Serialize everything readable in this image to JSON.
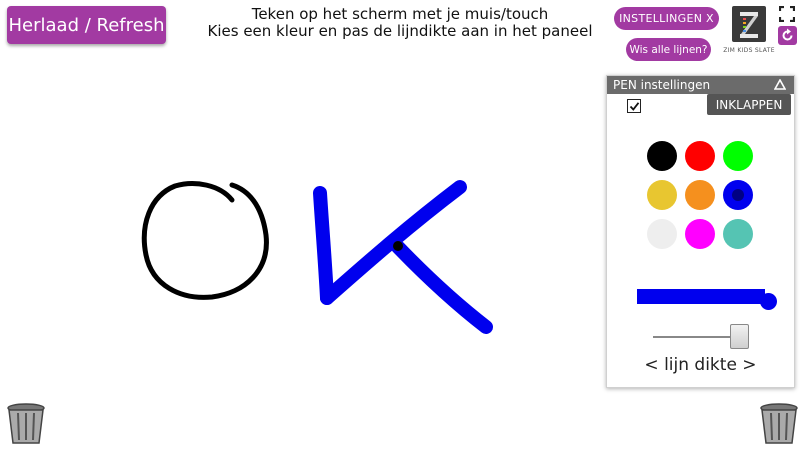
{
  "toolbar": {
    "refresh_label": "Herlaad / Refresh",
    "settings_label": "INSTELLINGEN X",
    "see_all_lines_label": "Wis alle lijnen?",
    "logo_caption": "ZIM KIDS SLATE"
  },
  "instructions": {
    "line1": "Teken op het scherm met je muis/touch",
    "line2": "Kies een kleur en pas de lijndikte aan in het paneel"
  },
  "panel": {
    "title": "PEN instellingen",
    "collapse_tooltip": "INKLAPPEN",
    "checkbox_checked": true,
    "swatches": [
      {
        "name": "black",
        "color": "#000000"
      },
      {
        "name": "red",
        "color": "#ff0000"
      },
      {
        "name": "green",
        "color": "#00ff00"
      },
      {
        "name": "yellow",
        "color": "#e8c630"
      },
      {
        "name": "orange",
        "color": "#f5901e"
      },
      {
        "name": "blue",
        "color": "#0000ee",
        "selected": true
      },
      {
        "name": "light-grey",
        "color": "#eeeeee"
      },
      {
        "name": "magenta",
        "color": "#ff00ff"
      },
      {
        "name": "teal",
        "color": "#55c4b3"
      }
    ],
    "pen_color": "#0000ee",
    "slider_value": 0.92,
    "slider_label": "< lijn dikte >"
  },
  "colors": {
    "accent": "#a23aa2",
    "panel_header": "#6b6b6b"
  },
  "icons": {
    "fullscreen": "fullscreen-icon",
    "reload": "reload-icon",
    "collapse": "triangle-up-icon",
    "trash": "trash-can-icon"
  }
}
